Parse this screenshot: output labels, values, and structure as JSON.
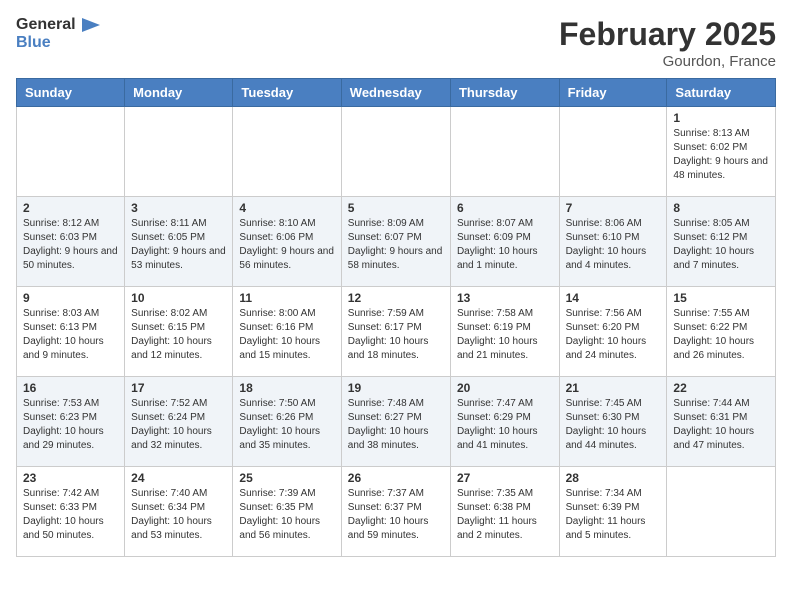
{
  "header": {
    "logo_general": "General",
    "logo_blue": "Blue",
    "month_year": "February 2025",
    "location": "Gourdon, France"
  },
  "weekdays": [
    "Sunday",
    "Monday",
    "Tuesday",
    "Wednesday",
    "Thursday",
    "Friday",
    "Saturday"
  ],
  "weeks": [
    [
      {
        "day": "",
        "info": ""
      },
      {
        "day": "",
        "info": ""
      },
      {
        "day": "",
        "info": ""
      },
      {
        "day": "",
        "info": ""
      },
      {
        "day": "",
        "info": ""
      },
      {
        "day": "",
        "info": ""
      },
      {
        "day": "1",
        "info": "Sunrise: 8:13 AM\nSunset: 6:02 PM\nDaylight: 9 hours and 48 minutes."
      }
    ],
    [
      {
        "day": "2",
        "info": "Sunrise: 8:12 AM\nSunset: 6:03 PM\nDaylight: 9 hours and 50 minutes."
      },
      {
        "day": "3",
        "info": "Sunrise: 8:11 AM\nSunset: 6:05 PM\nDaylight: 9 hours and 53 minutes."
      },
      {
        "day": "4",
        "info": "Sunrise: 8:10 AM\nSunset: 6:06 PM\nDaylight: 9 hours and 56 minutes."
      },
      {
        "day": "5",
        "info": "Sunrise: 8:09 AM\nSunset: 6:07 PM\nDaylight: 9 hours and 58 minutes."
      },
      {
        "day": "6",
        "info": "Sunrise: 8:07 AM\nSunset: 6:09 PM\nDaylight: 10 hours and 1 minute."
      },
      {
        "day": "7",
        "info": "Sunrise: 8:06 AM\nSunset: 6:10 PM\nDaylight: 10 hours and 4 minutes."
      },
      {
        "day": "8",
        "info": "Sunrise: 8:05 AM\nSunset: 6:12 PM\nDaylight: 10 hours and 7 minutes."
      }
    ],
    [
      {
        "day": "9",
        "info": "Sunrise: 8:03 AM\nSunset: 6:13 PM\nDaylight: 10 hours and 9 minutes."
      },
      {
        "day": "10",
        "info": "Sunrise: 8:02 AM\nSunset: 6:15 PM\nDaylight: 10 hours and 12 minutes."
      },
      {
        "day": "11",
        "info": "Sunrise: 8:00 AM\nSunset: 6:16 PM\nDaylight: 10 hours and 15 minutes."
      },
      {
        "day": "12",
        "info": "Sunrise: 7:59 AM\nSunset: 6:17 PM\nDaylight: 10 hours and 18 minutes."
      },
      {
        "day": "13",
        "info": "Sunrise: 7:58 AM\nSunset: 6:19 PM\nDaylight: 10 hours and 21 minutes."
      },
      {
        "day": "14",
        "info": "Sunrise: 7:56 AM\nSunset: 6:20 PM\nDaylight: 10 hours and 24 minutes."
      },
      {
        "day": "15",
        "info": "Sunrise: 7:55 AM\nSunset: 6:22 PM\nDaylight: 10 hours and 26 minutes."
      }
    ],
    [
      {
        "day": "16",
        "info": "Sunrise: 7:53 AM\nSunset: 6:23 PM\nDaylight: 10 hours and 29 minutes."
      },
      {
        "day": "17",
        "info": "Sunrise: 7:52 AM\nSunset: 6:24 PM\nDaylight: 10 hours and 32 minutes."
      },
      {
        "day": "18",
        "info": "Sunrise: 7:50 AM\nSunset: 6:26 PM\nDaylight: 10 hours and 35 minutes."
      },
      {
        "day": "19",
        "info": "Sunrise: 7:48 AM\nSunset: 6:27 PM\nDaylight: 10 hours and 38 minutes."
      },
      {
        "day": "20",
        "info": "Sunrise: 7:47 AM\nSunset: 6:29 PM\nDaylight: 10 hours and 41 minutes."
      },
      {
        "day": "21",
        "info": "Sunrise: 7:45 AM\nSunset: 6:30 PM\nDaylight: 10 hours and 44 minutes."
      },
      {
        "day": "22",
        "info": "Sunrise: 7:44 AM\nSunset: 6:31 PM\nDaylight: 10 hours and 47 minutes."
      }
    ],
    [
      {
        "day": "23",
        "info": "Sunrise: 7:42 AM\nSunset: 6:33 PM\nDaylight: 10 hours and 50 minutes."
      },
      {
        "day": "24",
        "info": "Sunrise: 7:40 AM\nSunset: 6:34 PM\nDaylight: 10 hours and 53 minutes."
      },
      {
        "day": "25",
        "info": "Sunrise: 7:39 AM\nSunset: 6:35 PM\nDaylight: 10 hours and 56 minutes."
      },
      {
        "day": "26",
        "info": "Sunrise: 7:37 AM\nSunset: 6:37 PM\nDaylight: 10 hours and 59 minutes."
      },
      {
        "day": "27",
        "info": "Sunrise: 7:35 AM\nSunset: 6:38 PM\nDaylight: 11 hours and 2 minutes."
      },
      {
        "day": "28",
        "info": "Sunrise: 7:34 AM\nSunset: 6:39 PM\nDaylight: 11 hours and 5 minutes."
      },
      {
        "day": "",
        "info": ""
      }
    ]
  ]
}
